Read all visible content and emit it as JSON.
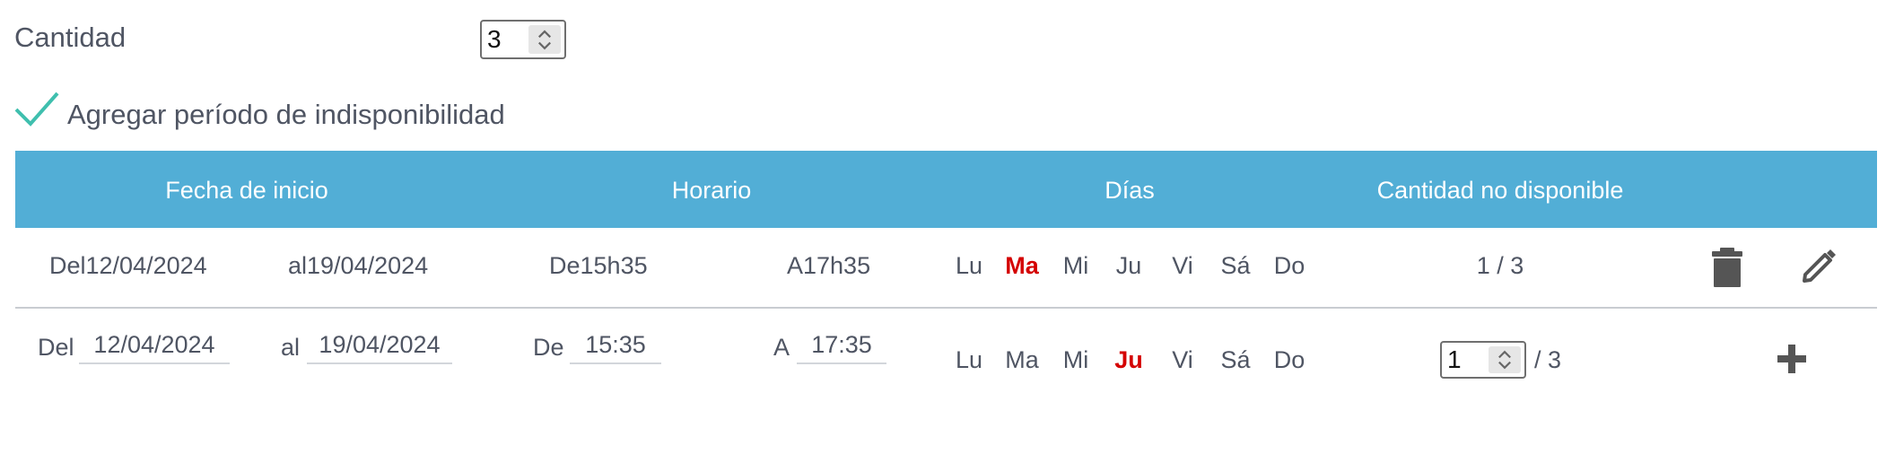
{
  "quantity": {
    "label": "Cantidad",
    "value": "3"
  },
  "add_period": {
    "label": "Agregar período de indisponibilidad",
    "checked": true
  },
  "table": {
    "headers": {
      "start_date": "Fecha de inicio",
      "schedule": "Horario",
      "days": "Días",
      "unavailable_qty": "Cantidad no disponible"
    },
    "rows": [
      {
        "from": "Del12/04/2024",
        "to": "al19/04/2024",
        "time_from": "De15h35",
        "time_to": "A17h35",
        "days": [
          "Lu",
          "Ma",
          "Mi",
          "Ju",
          "Vi",
          "Sá",
          "Do"
        ],
        "active_day": "Ma",
        "qty": "1 / 3"
      }
    ],
    "new_row": {
      "from_label": "Del",
      "from_value": "12/04/2024",
      "to_label": "al",
      "to_value": "19/04/2024",
      "time_from_label": "De",
      "time_from_value": "15:35",
      "time_to_label": "A",
      "time_to_value": "17:35",
      "days": [
        "Lu",
        "Ma",
        "Mi",
        "Ju",
        "Vi",
        "Sá",
        "Do"
      ],
      "active_day": "Ju",
      "qty_value": "1",
      "qty_total": "/ 3"
    }
  },
  "icons": {
    "check": "check-icon",
    "delete": "trash-icon",
    "edit": "pencil-icon",
    "add": "plus-icon",
    "spinner": "chevron-up-down-icon"
  },
  "colors": {
    "header_bg": "#52aed6",
    "accent_check": "#3fbfae",
    "active_day": "#d40000",
    "text": "#4f5563"
  }
}
